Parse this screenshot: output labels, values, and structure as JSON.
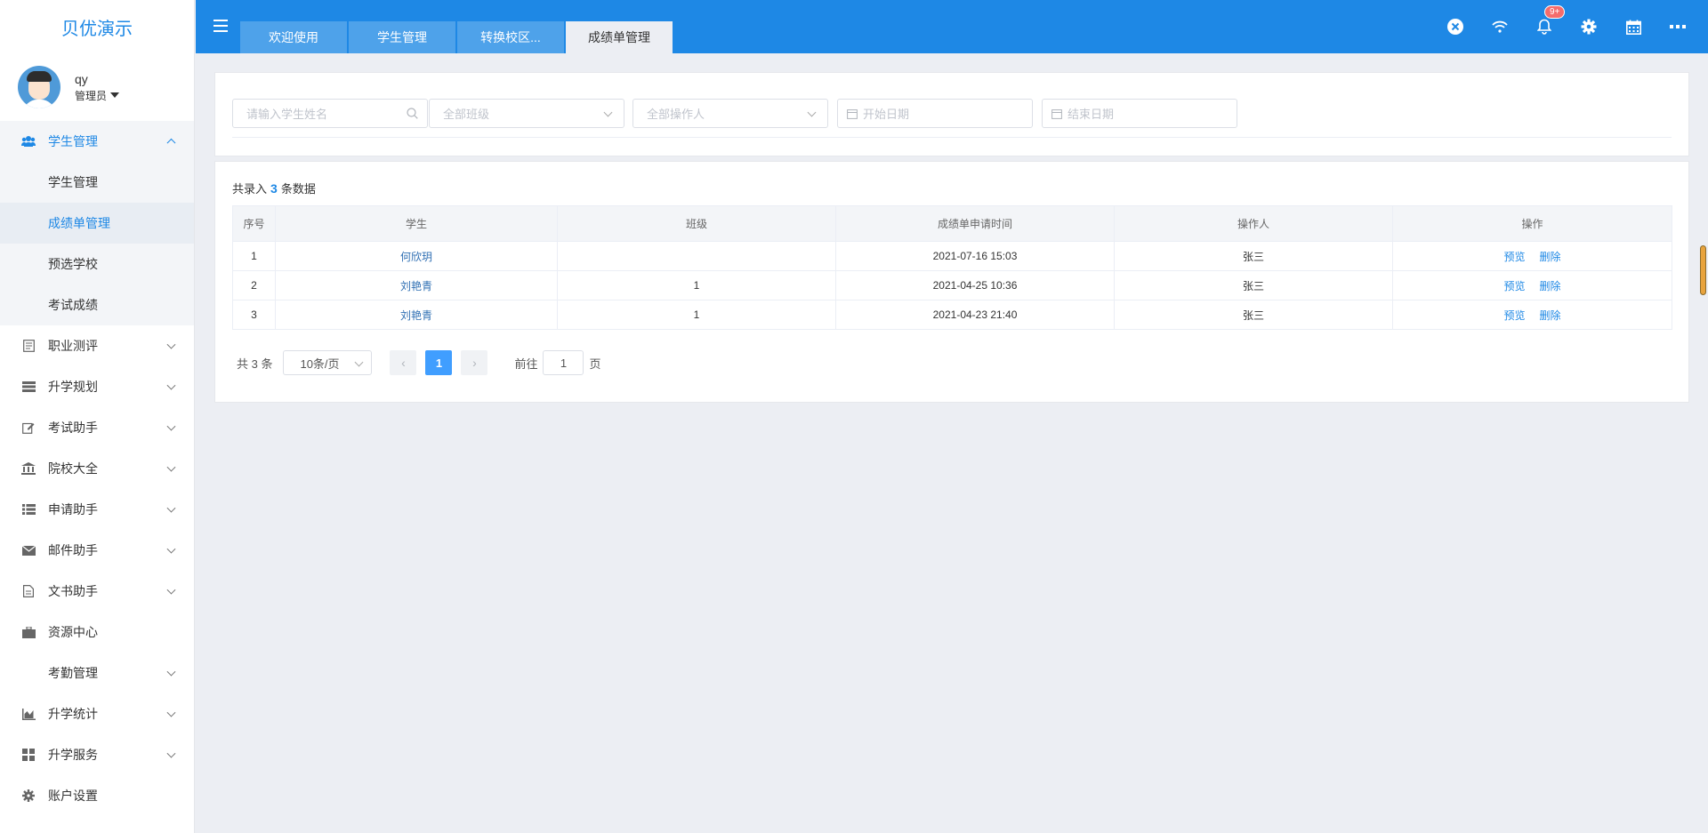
{
  "brand": "贝优演示",
  "user": {
    "name": "qy",
    "role": "管理员"
  },
  "sidebar": {
    "active_group": {
      "label": "学生管理",
      "icon": "users-icon"
    },
    "sub_items": [
      {
        "label": "学生管理"
      },
      {
        "label": "成绩单管理"
      },
      {
        "label": "预选学校"
      },
      {
        "label": "考试成绩"
      }
    ],
    "items": [
      {
        "label": "职业测评",
        "icon": "clipboard-icon",
        "has_arrow": true
      },
      {
        "label": "升学规划",
        "icon": "server-icon",
        "has_arrow": true
      },
      {
        "label": "考试助手",
        "icon": "edit-icon",
        "has_arrow": true
      },
      {
        "label": "院校大全",
        "icon": "institution-icon",
        "has_arrow": true
      },
      {
        "label": "申请助手",
        "icon": "list-icon",
        "has_arrow": true
      },
      {
        "label": "邮件助手",
        "icon": "envelope-icon",
        "has_arrow": true
      },
      {
        "label": "文书助手",
        "icon": "document-icon",
        "has_arrow": true
      },
      {
        "label": "资源中心",
        "icon": "briefcase-icon",
        "has_arrow": false
      },
      {
        "label": "考勤管理",
        "icon": "",
        "has_arrow": true
      },
      {
        "label": "升学统计",
        "icon": "area-chart-icon",
        "has_arrow": true
      },
      {
        "label": "升学服务",
        "icon": "grid-icon",
        "has_arrow": true
      },
      {
        "label": "账户设置",
        "icon": "gear-icon",
        "has_arrow": false
      }
    ]
  },
  "tabs": [
    {
      "label": "欢迎使用"
    },
    {
      "label": "学生管理"
    },
    {
      "label": "转换校区..."
    },
    {
      "label": "成绩单管理"
    }
  ],
  "header": {
    "notification_badge": "9+"
  },
  "filters": {
    "student_name_placeholder": "请输入学生姓名",
    "class_placeholder": "全部班级",
    "operator_placeholder": "全部操作人",
    "start_date_placeholder": "开始日期",
    "end_date_placeholder": "结束日期"
  },
  "summary": {
    "prefix": "共录入",
    "count": "3",
    "suffix": "条数据"
  },
  "table": {
    "columns": [
      "序号",
      "学生",
      "班级",
      "成绩单申请时间",
      "操作人",
      "操作"
    ],
    "rows": [
      {
        "index": "1",
        "student": "何欣玥",
        "class": "",
        "time": "2021-07-16 15:03",
        "operator": "张三"
      },
      {
        "index": "2",
        "student": "刘艳青",
        "class": "1",
        "time": "2021-04-25 10:36",
        "operator": "张三"
      },
      {
        "index": "3",
        "student": "刘艳青",
        "class": "1",
        "time": "2021-04-23 21:40",
        "operator": "张三"
      }
    ],
    "action_preview": "预览",
    "action_delete": "删除"
  },
  "pagination": {
    "total_text": "共 3 条",
    "page_size": "10条/页",
    "current_page": "1",
    "goto_label": "前往",
    "goto_value": "1",
    "page_suffix": "页"
  },
  "colors": {
    "primary": "#1e88e5",
    "tab_inactive": "#4ea2ea",
    "badge": "#f56c6c"
  }
}
